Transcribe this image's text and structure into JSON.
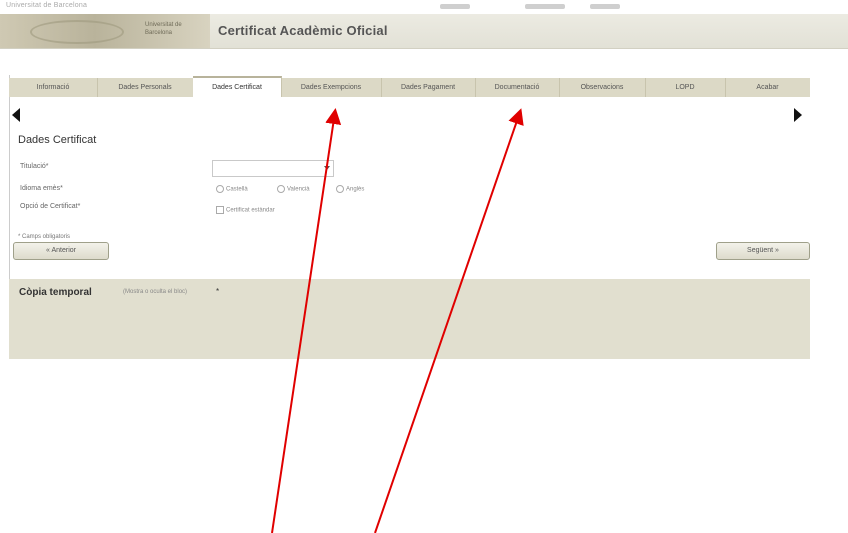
{
  "topbar": {
    "text": "Universitat de Barcelona"
  },
  "header": {
    "logo_text": "Universitat de Barcelona",
    "title": "Certificat Acadèmic Oficial"
  },
  "tabs": [
    {
      "label": "Informació"
    },
    {
      "label": "Dades Personals"
    },
    {
      "label": "Dades Certificat"
    },
    {
      "label": "Dades Exempcions"
    },
    {
      "label": "Dades Pagament"
    },
    {
      "label": "Documentació"
    },
    {
      "label": "Observacions"
    },
    {
      "label": "LOPD"
    },
    {
      "label": "Acabar"
    }
  ],
  "active_tab": "Dades Certificat",
  "form": {
    "section_title": "Dades Certificat",
    "labels": {
      "titulacio": "Titulació*",
      "idioma": "Idioma emès*",
      "opcio": "Opció de Certificat*"
    },
    "select_value": "",
    "radios": [
      "Castellà",
      "Valencià",
      "Anglès"
    ],
    "checkbox_label": "Certificat estàndar",
    "required_note": "* Camps obligatoris",
    "btn_prev": "« Anterior",
    "btn_next": "Següent »"
  },
  "copia": {
    "title": "Còpia temporal",
    "link": "(Mostra o oculta el bloc)",
    "star": "*"
  },
  "colors": {
    "tab_bar": "#dcd9c6",
    "panel": "#e1dfcf",
    "annotation_arrows": "#e00000"
  }
}
